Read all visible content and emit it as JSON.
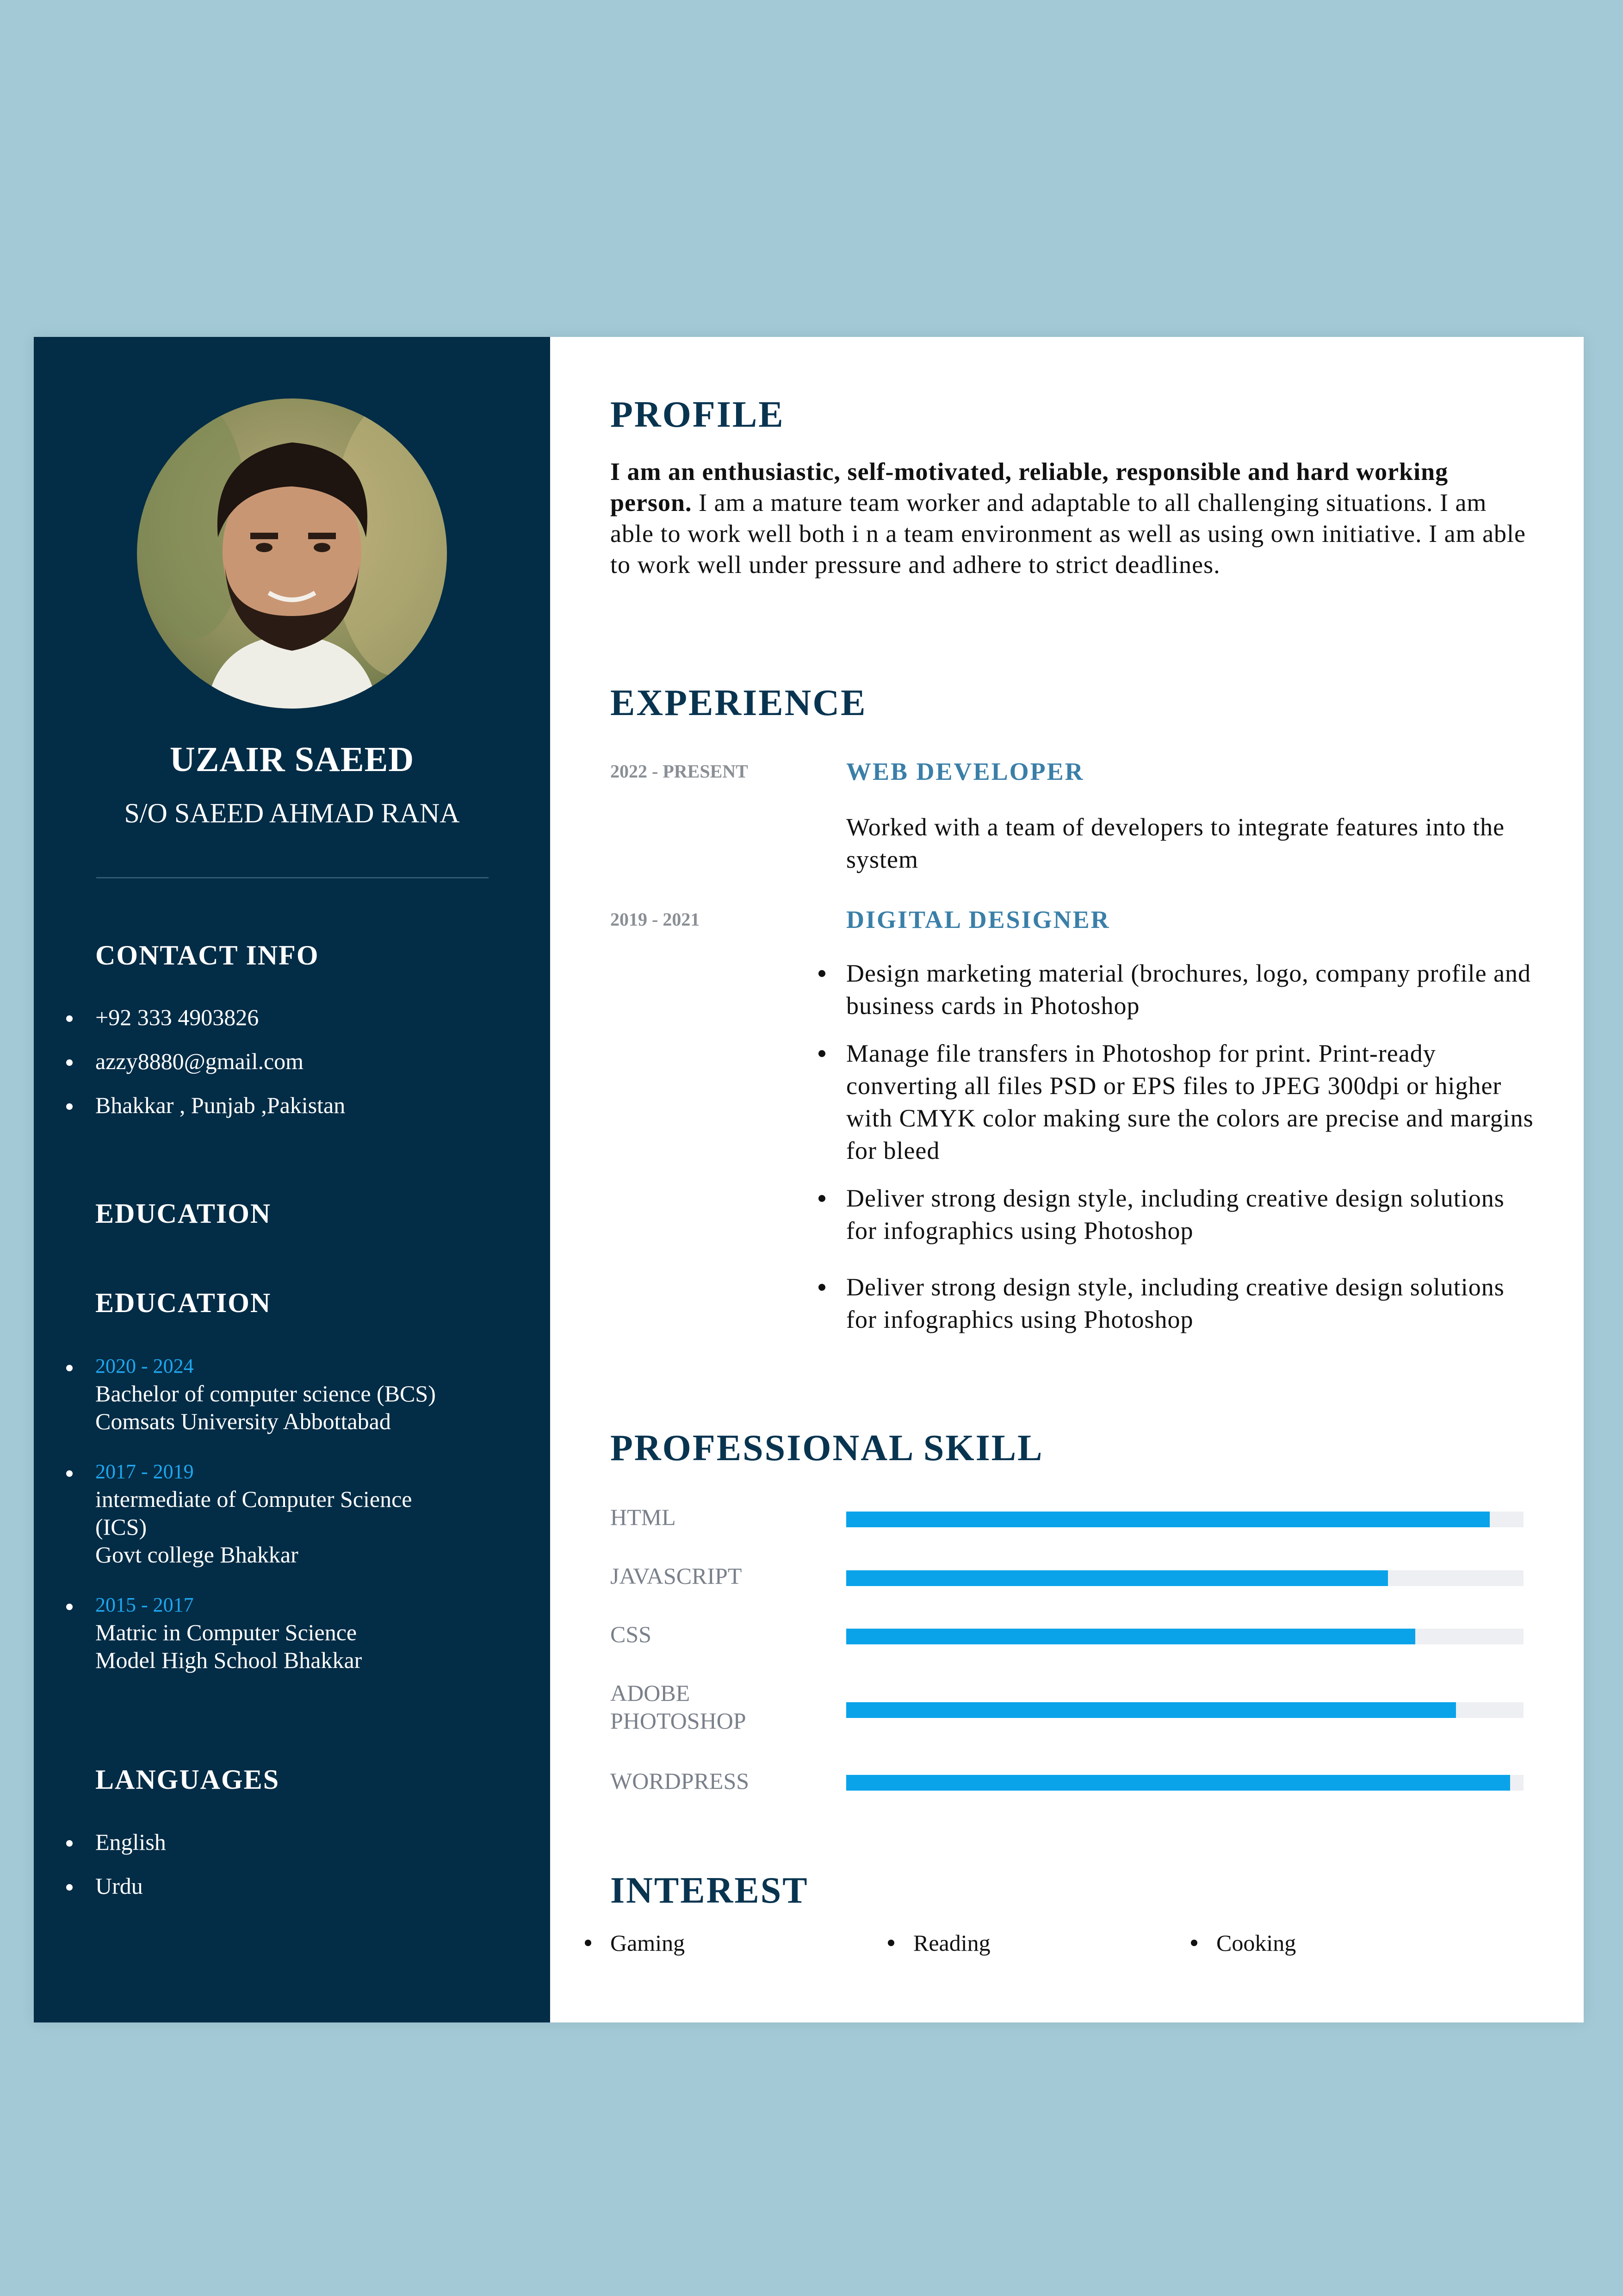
{
  "sidebar": {
    "name": "UZAIR SAEED",
    "parent": "S/O SAEED AHMAD RANA",
    "contact_heading": "CONTACT INFO",
    "contacts": [
      "+92 333 4903826",
      "azzy8880@gmail.com",
      "Bhakkar , Punjab ,Pakistan"
    ],
    "education_heading_1": "EDUCATION",
    "education_heading_2": "EDUCATION",
    "education": [
      {
        "years": "2020 - 2024",
        "lines": [
          "Bachelor of computer science (BCS)",
          "Comsats University Abbottabad"
        ]
      },
      {
        "years": "2017 - 2019",
        "lines": [
          "intermediate of Computer Science",
          "(ICS)",
          "Govt college Bhakkar"
        ]
      },
      {
        "years": "2015 - 2017",
        "lines": [
          "Matric in Computer Science",
          "Model High School Bhakkar"
        ]
      }
    ],
    "languages_heading": "LANGUAGES",
    "languages": [
      "English",
      "Urdu"
    ]
  },
  "main": {
    "profile_heading": "PROFILE",
    "profile_bold": "I am an enthusiastic, self-motivated, reliable, responsible and hard working person.",
    "profile_text": " I am a mature team worker and adaptable to all challenging situations. I am able to work well both i n a team environment as well as using own initiative. I am able to work well under pressure and adhere to strict deadlines.",
    "experience_heading": "EXPERIENCE",
    "experience": [
      {
        "dates": "2022 - PRESENT",
        "title": "WEB DEVELOPER",
        "description": "Worked with a team of developers to integrate features into the system"
      },
      {
        "dates": "2019 - 2021",
        "title": "DIGITAL DESIGNER",
        "bullets": [
          "Design marketing material (brochures, logo, company profile and business cards in Photoshop",
          "Manage file transfers in Photoshop for print. Print-ready converting all files PSD or EPS files to JPEG 300dpi or higher with CMYK color making sure the colors are precise and margins for bleed",
          "Deliver strong design style, including creative design solutions for infographics using Photoshop",
          "Deliver strong design style, including creative design solutions for infographics using Photoshop"
        ]
      }
    ],
    "skills_heading": "PROFESSIONAL SKILL",
    "skills": [
      {
        "name": "HTML",
        "level": 0.95
      },
      {
        "name": "JAVASCRIPT",
        "level": 0.8
      },
      {
        "name": "CSS",
        "level": 0.84
      },
      {
        "name": "ADOBE PHOTOSHOP",
        "level": 0.9
      },
      {
        "name": "WORDPRESS",
        "level": 0.98
      }
    ],
    "interest_heading": "INTEREST",
    "interests": [
      "Gaming",
      "Reading",
      "Cooking"
    ]
  },
  "colors": {
    "sidebar_bg": "#032c46",
    "accent": "#0aa3ea",
    "heading": "#083450",
    "page_bg": "#a3c9d6"
  }
}
